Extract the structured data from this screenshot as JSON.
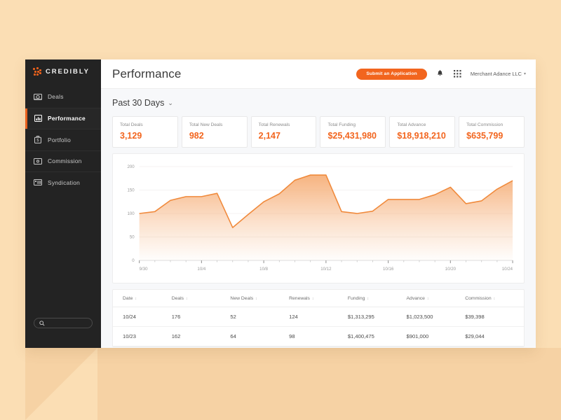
{
  "brand": {
    "name": "CREDIBLY",
    "accent": "#E8601C",
    "button_accent": "#F2651E",
    "page_bg": "#FBDEB4",
    "shadow": "#F6D2A4"
  },
  "sidebar": {
    "items": [
      {
        "label": "Deals",
        "icon": "money-card-icon",
        "active": false
      },
      {
        "label": "Performance",
        "icon": "bar-chart-icon",
        "active": true
      },
      {
        "label": "Portfolio",
        "icon": "briefcase-dollar-icon",
        "active": false
      },
      {
        "label": "Commission",
        "icon": "credit-card-icon",
        "active": false
      },
      {
        "label": "Syndication",
        "icon": "list-chart-icon",
        "active": false
      }
    ],
    "search": {
      "placeholder": "",
      "value": "",
      "icon": "search-icon"
    }
  },
  "header": {
    "title": "Performance",
    "submit_label": "Submit an Application",
    "notifications_icon": "bell-icon",
    "apps_icon": "grid-apps-icon",
    "account_label": "Merchant Adance LLC",
    "caret": "▾"
  },
  "range": {
    "label": "Past 30 Days",
    "caret": "⌄"
  },
  "stats": [
    {
      "label": "Total Deals",
      "value": "3,129"
    },
    {
      "label": "Total New Deals",
      "value": "982"
    },
    {
      "label": "Total Renewals",
      "value": "2,147"
    },
    {
      "label": "Total Funding",
      "value": "$25,431,980"
    },
    {
      "label": "Total Advance",
      "value": "$18,918,210"
    },
    {
      "label": "Total Commission",
      "value": "$635,799"
    }
  ],
  "chart_data": {
    "type": "area",
    "title": "",
    "xlabel": "",
    "ylabel": "",
    "ylim": [
      0,
      200
    ],
    "yticks": [
      0,
      50,
      100,
      150,
      200
    ],
    "grid": true,
    "legend": false,
    "line_color": "#F08A3C",
    "fill_top": "#F6B07A",
    "fill_bottom": "#FFFFFF",
    "x": [
      "9/30",
      "10/1",
      "10/2",
      "10/3",
      "10/4",
      "10/5",
      "10/6",
      "10/7",
      "10/8",
      "10/9",
      "10/10",
      "10/11",
      "10/12",
      "10/13",
      "10/14",
      "10/15",
      "10/16",
      "10/17",
      "10/18",
      "10/19",
      "10/20",
      "10/21",
      "10/22",
      "10/23",
      "10/24"
    ],
    "xticks": [
      "9/30",
      "10/4",
      "10/8",
      "10/12",
      "10/16",
      "10/20",
      "10/24"
    ],
    "series": [
      {
        "name": "Deals",
        "values": [
          100,
          104,
          128,
          136,
          136,
          143,
          70,
          98,
          125,
          142,
          171,
          182,
          182,
          104,
          100,
          105,
          130,
          130,
          130,
          140,
          156,
          121,
          127,
          152,
          170
        ]
      }
    ]
  },
  "table": {
    "columns": [
      "Date",
      "Deals",
      "New Deals",
      "Renewals",
      "Funding",
      "Advance",
      "Commission"
    ],
    "sort_icon": "↕",
    "rows": [
      {
        "date": "10/24",
        "deals": "176",
        "new_deals": "52",
        "renewals": "124",
        "funding": "$1,313,295",
        "advance": "$1,023,500",
        "commission": "$39,398"
      },
      {
        "date": "10/23",
        "deals": "162",
        "new_deals": "64",
        "renewals": "98",
        "funding": "$1,400,475",
        "advance": "$901,000",
        "commission": "$29,044"
      }
    ]
  }
}
